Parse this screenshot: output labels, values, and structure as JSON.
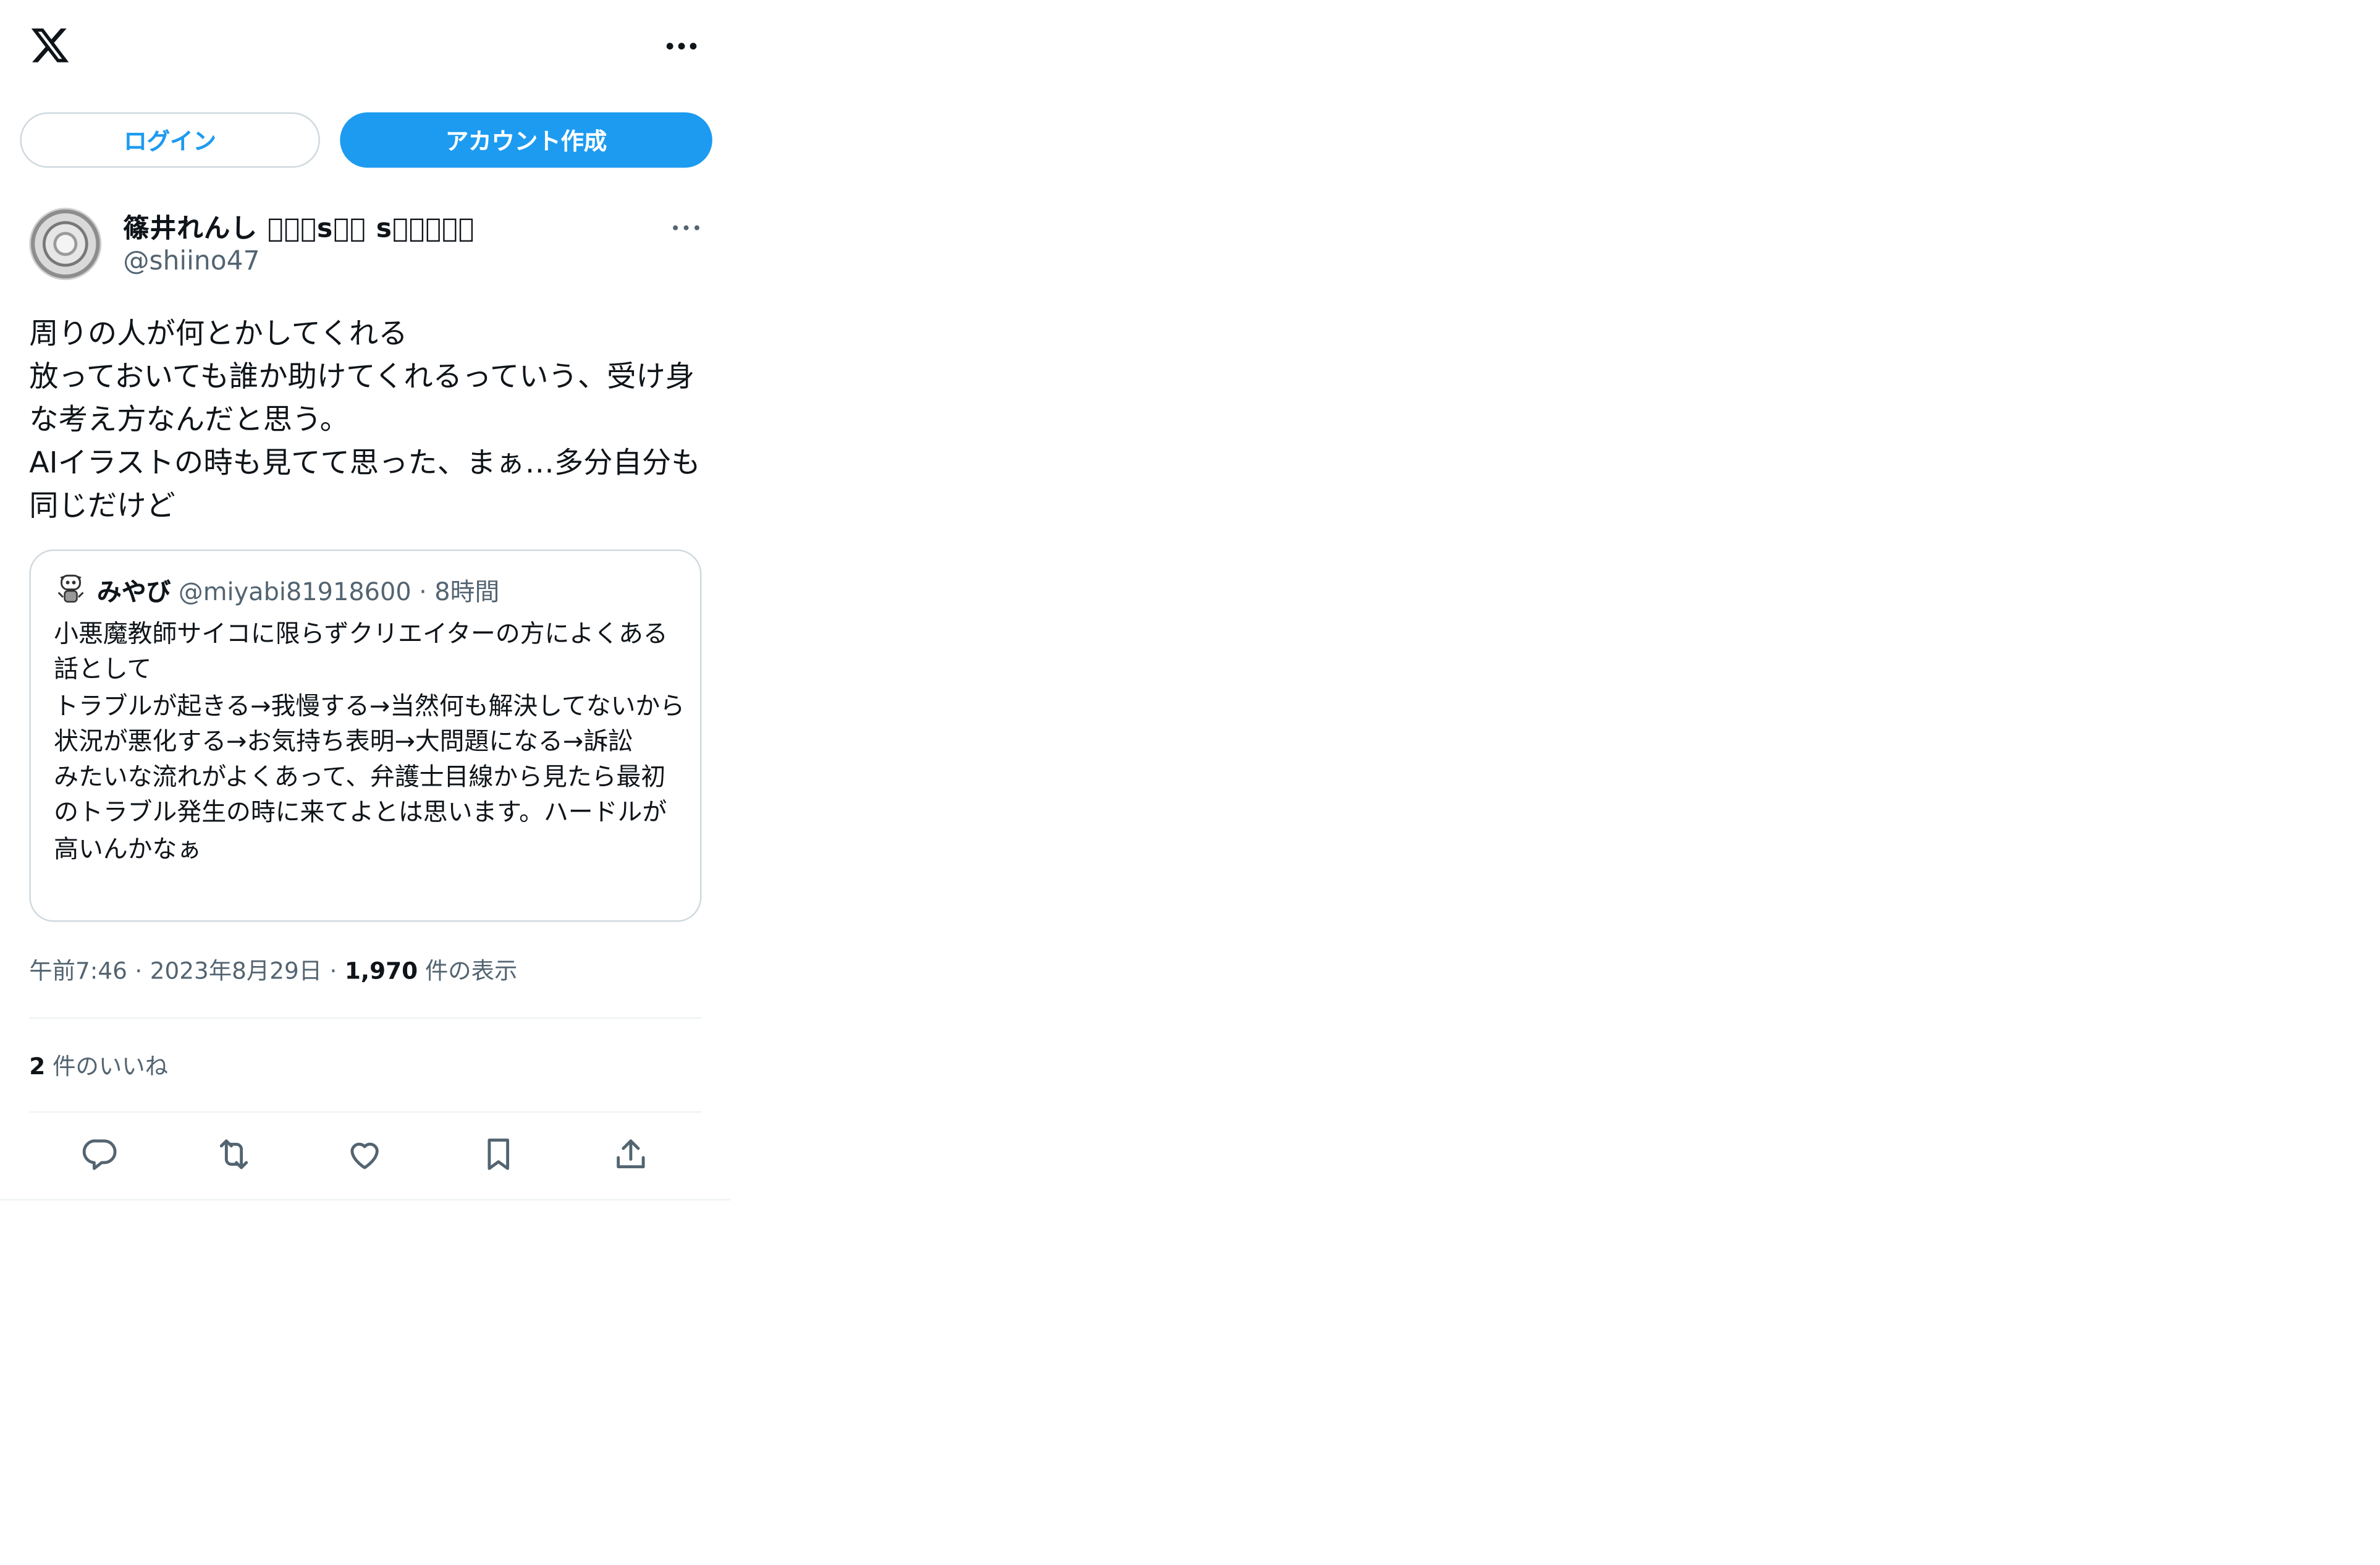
{
  "header": {
    "logo": "x-logo",
    "more_icon": "more-horizontal-icon"
  },
  "auth": {
    "login_label": "ログイン",
    "signup_label": "アカウント作成",
    "signup_color": "#1d9bf0"
  },
  "tweet": {
    "author": {
      "display_name": "篠井れんし 􀀀􀀀􀀀s􀀀􀀀 s􀀀􀀀􀀀􀀀􀀀",
      "handle": "@shiino47"
    },
    "text": "周りの人が何とかしてくれる\n放っておいても誰か助けてくれるっていう、受け身な考え方なんだと思う。\nAIイラストの時も見てて思った、まぁ…多分自分も同じだけど",
    "quote": {
      "author_name": "みやび",
      "author_handle": "@miyabi81918600",
      "separator": "·",
      "time": "8時間",
      "text": "小悪魔教師サイコに限らずクリエイターの方によくある話として\nトラブルが起きる→我慢する→当然何も解決してないから状況が悪化する→お気持ち表明→大問題になる→訴訟\nみたいな流れがよくあって、弁護士目線から見たら最初のトラブル発生の時に来てよとは思います。ハードルが高いんかなぁ"
    },
    "meta": {
      "time": "午前7:46",
      "separator": "·",
      "date": "2023年8月29日",
      "separator2": "·",
      "views_count": "1,970",
      "views_label": " 件の表示"
    },
    "likes": {
      "count": "2",
      "label": " 件のいいね"
    },
    "actions": {
      "reply_icon": "reply-icon",
      "retweet_icon": "retweet-icon",
      "like_icon": "heart-icon",
      "bookmark_icon": "bookmark-icon",
      "share_icon": "share-icon"
    }
  },
  "colors": {
    "text_primary": "#0f1419",
    "text_secondary": "#536471",
    "border": "#cfd9de",
    "divider": "#eff3f4"
  }
}
